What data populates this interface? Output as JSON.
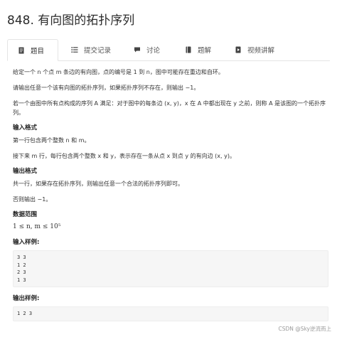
{
  "page": {
    "title": "848. 有向图的拓扑序列"
  },
  "tabs": [
    {
      "label": "题目",
      "icon": "document-icon",
      "active": true
    },
    {
      "label": "提交记录",
      "icon": "list-icon",
      "active": false
    },
    {
      "label": "讨论",
      "icon": "chat-icon",
      "active": false
    },
    {
      "label": "题解",
      "icon": "book-icon",
      "active": false
    },
    {
      "label": "视频讲解",
      "icon": "video-icon",
      "active": false
    }
  ],
  "problem": {
    "p1": "给定一个 n 个点 m 条边的有向图，点的编号是 1 到 n，图中可能存在重边和自环。",
    "p2": "请输出任意一个该有向图的拓扑序列，如果拓扑序列不存在，则输出 −1。",
    "p3": "若一个由图中所有点构成的序列 A 满足：对于图中的每条边 (x, y)，x 在 A 中都出现在 y 之前，则称 A 是该图的一个拓扑序列。",
    "input_format_title": "输入格式",
    "input_format_1": "第一行包含两个整数 n 和 m。",
    "input_format_2": "接下来 m 行，每行包含两个整数 x 和 y，表示存在一条从点 x 到点 y 的有向边 (x, y)。",
    "output_format_title": "输出格式",
    "output_format_1": "共一行，如果存在拓扑序列，则输出任意一个合法的拓扑序列即可。",
    "output_format_2": "否则输出 −1。",
    "range_title": "数据范围",
    "range_text": "1 ≤ n, m ≤ 10⁵",
    "sample_input_title": "输入样例:",
    "sample_input_lines": [
      "3 3",
      "1 2",
      "2 3",
      "1 3"
    ],
    "sample_output_title": "输出样例:",
    "sample_output_lines": [
      "1 2 3"
    ]
  },
  "watermark": "CSDN @Sky逆流而上"
}
